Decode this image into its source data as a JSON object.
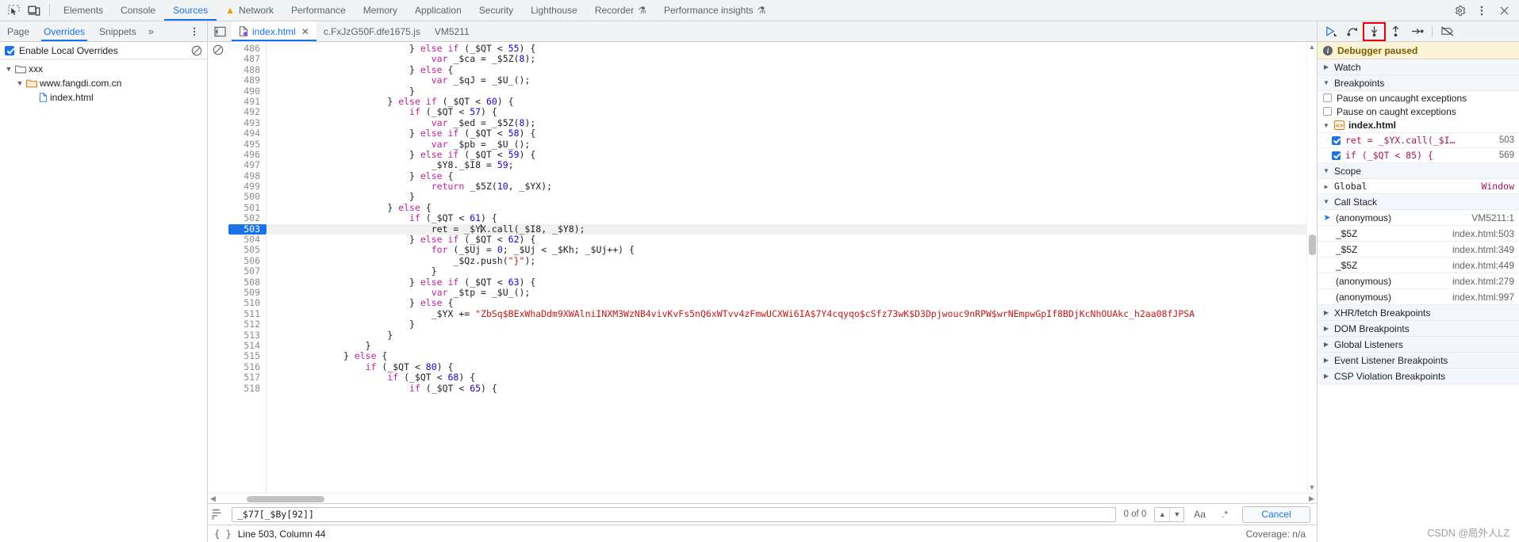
{
  "main_toolbar": {
    "inspect_icon": "inspect-cursor-icon",
    "device_icon": "device-toolbar-icon",
    "tabs": [
      {
        "label": "Elements",
        "active": false,
        "warn": false
      },
      {
        "label": "Console",
        "active": false,
        "warn": false
      },
      {
        "label": "Sources",
        "active": true,
        "warn": false
      },
      {
        "label": "Network",
        "active": false,
        "warn": true
      },
      {
        "label": "Performance",
        "active": false,
        "warn": false
      },
      {
        "label": "Memory",
        "active": false,
        "warn": false
      },
      {
        "label": "Application",
        "active": false,
        "warn": false
      },
      {
        "label": "Security",
        "active": false,
        "warn": false
      },
      {
        "label": "Lighthouse",
        "active": false,
        "warn": false
      },
      {
        "label": "Recorder",
        "active": false,
        "flask": true
      },
      {
        "label": "Performance insights",
        "active": false,
        "flask": true
      }
    ],
    "settings_icon": "gear-icon",
    "more_icon": "three-dots-vertical-icon",
    "close_icon": "close-icon"
  },
  "navigator": {
    "tabs": [
      {
        "label": "Page",
        "active": false
      },
      {
        "label": "Overrides",
        "active": true
      },
      {
        "label": "Snippets",
        "active": false
      }
    ],
    "more_tabs_icon": "chevron-double-right-icon",
    "more_options_icon": "three-dots-vertical-icon",
    "enable_overrides_label": "Enable Local Overrides",
    "enable_overrides_checked": true,
    "clear_icon": "no-entry-icon",
    "tree": [
      {
        "label": "xxx",
        "depth": 0,
        "type": "folder",
        "expanded": true,
        "color": "#5f6368"
      },
      {
        "label": "www.fangdi.com.cn",
        "depth": 1,
        "type": "folder",
        "expanded": true,
        "color": "#e37400"
      },
      {
        "label": "index.html",
        "depth": 2,
        "type": "file",
        "expanded": false,
        "color": "#1a73e8"
      }
    ]
  },
  "editor_tabs": {
    "panel_toggle_icon": "show-navigator-icon",
    "tabs": [
      {
        "label": "index.html",
        "active": true,
        "closable": true,
        "dot": true
      },
      {
        "label": "c.FxJzG50F.dfe1675.js",
        "active": false,
        "closable": false,
        "dot": false
      },
      {
        "label": "VM5211",
        "active": false,
        "closable": false,
        "dot": false
      }
    ],
    "close_icon": "close-icon"
  },
  "debug_buttons": [
    {
      "name": "resume-script-execution",
      "icon": "resume-icon",
      "highlighted": false
    },
    {
      "name": "step-over-next-function-call",
      "icon": "step-over-icon",
      "highlighted": false
    },
    {
      "name": "step-into-next-function-call",
      "icon": "step-into-icon",
      "highlighted": true
    },
    {
      "name": "step-out-of-current-function",
      "icon": "step-out-icon",
      "highlighted": false
    },
    {
      "name": "step",
      "icon": "step-icon",
      "highlighted": false
    },
    {
      "name": "deactivate-breakpoints",
      "icon": "deactivate-breakpoints-icon",
      "highlighted": false
    }
  ],
  "editor": {
    "breakpoint_gutter_icon": "no-entry-icon",
    "current_line": 503,
    "first_line": 486,
    "lines": [
      {
        "n": 486,
        "indent": 26,
        "tokens": [
          [
            "pln",
            "} "
          ],
          [
            "kw",
            "else if"
          ],
          [
            "pln",
            " (_$QT < "
          ],
          [
            "num",
            "55"
          ],
          [
            "pln",
            ") {"
          ]
        ]
      },
      {
        "n": 487,
        "indent": 30,
        "tokens": [
          [
            "kw",
            "var"
          ],
          [
            "pln",
            " _$ca = _$5Z("
          ],
          [
            "num",
            "8"
          ],
          [
            "pln",
            ");"
          ]
        ]
      },
      {
        "n": 488,
        "indent": 26,
        "tokens": [
          [
            "pln",
            "} "
          ],
          [
            "kw",
            "else"
          ],
          [
            "pln",
            " {"
          ]
        ]
      },
      {
        "n": 489,
        "indent": 30,
        "tokens": [
          [
            "kw",
            "var"
          ],
          [
            "pln",
            " _$qJ = _$U_();"
          ]
        ]
      },
      {
        "n": 490,
        "indent": 26,
        "tokens": [
          [
            "pln",
            "}"
          ]
        ]
      },
      {
        "n": 491,
        "indent": 22,
        "tokens": [
          [
            "pln",
            "} "
          ],
          [
            "kw",
            "else if"
          ],
          [
            "pln",
            " (_$QT < "
          ],
          [
            "num",
            "60"
          ],
          [
            "pln",
            ") {"
          ]
        ]
      },
      {
        "n": 492,
        "indent": 26,
        "tokens": [
          [
            "kw",
            "if"
          ],
          [
            "pln",
            " (_$QT < "
          ],
          [
            "num",
            "57"
          ],
          [
            "pln",
            ") {"
          ]
        ]
      },
      {
        "n": 493,
        "indent": 30,
        "tokens": [
          [
            "kw",
            "var"
          ],
          [
            "pln",
            " _$ed = _$5Z("
          ],
          [
            "num",
            "8"
          ],
          [
            "pln",
            ");"
          ]
        ]
      },
      {
        "n": 494,
        "indent": 26,
        "tokens": [
          [
            "pln",
            "} "
          ],
          [
            "kw",
            "else if"
          ],
          [
            "pln",
            " (_$QT < "
          ],
          [
            "num",
            "58"
          ],
          [
            "pln",
            ") {"
          ]
        ]
      },
      {
        "n": 495,
        "indent": 30,
        "tokens": [
          [
            "kw",
            "var"
          ],
          [
            "pln",
            " _$pb = _$U_();"
          ]
        ]
      },
      {
        "n": 496,
        "indent": 26,
        "tokens": [
          [
            "pln",
            "} "
          ],
          [
            "kw",
            "else if"
          ],
          [
            "pln",
            " (_$QT < "
          ],
          [
            "num",
            "59"
          ],
          [
            "pln",
            ") {"
          ]
        ]
      },
      {
        "n": 497,
        "indent": 30,
        "tokens": [
          [
            "pln",
            "_$Y8._$I8 = "
          ],
          [
            "num",
            "59"
          ],
          [
            "pln",
            ";"
          ]
        ]
      },
      {
        "n": 498,
        "indent": 26,
        "tokens": [
          [
            "pln",
            "} "
          ],
          [
            "kw",
            "else"
          ],
          [
            "pln",
            " {"
          ]
        ]
      },
      {
        "n": 499,
        "indent": 30,
        "tokens": [
          [
            "kw",
            "return"
          ],
          [
            "pln",
            " _$5Z("
          ],
          [
            "num",
            "10"
          ],
          [
            "pln",
            ", _$YX);"
          ]
        ]
      },
      {
        "n": 500,
        "indent": 26,
        "tokens": [
          [
            "pln",
            "}"
          ]
        ]
      },
      {
        "n": 501,
        "indent": 22,
        "tokens": [
          [
            "pln",
            "} "
          ],
          [
            "kw",
            "else"
          ],
          [
            "pln",
            " {"
          ]
        ]
      },
      {
        "n": 502,
        "indent": 26,
        "tokens": [
          [
            "kw",
            "if"
          ],
          [
            "pln",
            " (_$QT < "
          ],
          [
            "num",
            "61"
          ],
          [
            "pln",
            ") {"
          ]
        ]
      },
      {
        "n": 503,
        "indent": 30,
        "tokens": [
          [
            "pln",
            "ret = _$Y"
          ],
          [
            "caret",
            ""
          ],
          [
            "pln",
            "X.call(_$I8, _$Y8);"
          ]
        ],
        "highlight": true
      },
      {
        "n": 504,
        "indent": 26,
        "tokens": [
          [
            "pln",
            "} "
          ],
          [
            "kw",
            "else if"
          ],
          [
            "pln",
            " (_$QT < "
          ],
          [
            "num",
            "62"
          ],
          [
            "pln",
            ") {"
          ]
        ]
      },
      {
        "n": 505,
        "indent": 30,
        "tokens": [
          [
            "kw",
            "for"
          ],
          [
            "pln",
            " (_$Uj = "
          ],
          [
            "num",
            "0"
          ],
          [
            "pln",
            "; _$Uj < _$Kh; _$Uj++) {"
          ]
        ]
      },
      {
        "n": 506,
        "indent": 34,
        "tokens": [
          [
            "pln",
            "_$Qz.push("
          ],
          [
            "str",
            "\"}\""
          ],
          [
            "pln",
            ");"
          ]
        ]
      },
      {
        "n": 507,
        "indent": 30,
        "tokens": [
          [
            "pln",
            "}"
          ]
        ]
      },
      {
        "n": 508,
        "indent": 26,
        "tokens": [
          [
            "pln",
            "} "
          ],
          [
            "kw",
            "else if"
          ],
          [
            "pln",
            " (_$QT < "
          ],
          [
            "num",
            "63"
          ],
          [
            "pln",
            ") {"
          ]
        ]
      },
      {
        "n": 509,
        "indent": 30,
        "tokens": [
          [
            "kw",
            "var"
          ],
          [
            "pln",
            " _$tp = _$U_();"
          ]
        ]
      },
      {
        "n": 510,
        "indent": 26,
        "tokens": [
          [
            "pln",
            "} "
          ],
          [
            "kw",
            "else"
          ],
          [
            "pln",
            " {"
          ]
        ]
      },
      {
        "n": 511,
        "indent": 30,
        "tokens": [
          [
            "pln",
            "_$YX += "
          ],
          [
            "str",
            "\"ZbSq$BExWhaDdm9XWAlniINXM3WzNB4vivKvFs5nQ6xWTvv4zFmwUCXWi6IA$7Y4cqyqo$cSfz73wK$D3Dpjwouc9nRPW$wrNEmpwGpIf8BDjKcNhOUAkc_h2aa08fJPSA"
          ]
        ]
      },
      {
        "n": 512,
        "indent": 26,
        "tokens": [
          [
            "pln",
            "}"
          ]
        ]
      },
      {
        "n": 513,
        "indent": 22,
        "tokens": [
          [
            "pln",
            "}"
          ]
        ]
      },
      {
        "n": 514,
        "indent": 18,
        "tokens": [
          [
            "pln",
            "}"
          ]
        ]
      },
      {
        "n": 515,
        "indent": 14,
        "tokens": [
          [
            "pln",
            "} "
          ],
          [
            "kw",
            "else"
          ],
          [
            "pln",
            " {"
          ]
        ]
      },
      {
        "n": 516,
        "indent": 18,
        "tokens": [
          [
            "kw",
            "if"
          ],
          [
            "pln",
            " (_$QT < "
          ],
          [
            "num",
            "80"
          ],
          [
            "pln",
            ") {"
          ]
        ]
      },
      {
        "n": 517,
        "indent": 22,
        "tokens": [
          [
            "kw",
            "if"
          ],
          [
            "pln",
            " (_$QT < "
          ],
          [
            "num",
            "68"
          ],
          [
            "pln",
            ") {"
          ]
        ]
      },
      {
        "n": 518,
        "indent": 26,
        "tokens": [
          [
            "kw",
            "if"
          ],
          [
            "pln",
            " (_$QT < "
          ],
          [
            "num",
            "65"
          ],
          [
            "pln",
            ") {"
          ]
        ]
      }
    ],
    "scroll_left_icon": "chevron-left-icon",
    "scroll_right_icon": "chevron-right-icon",
    "scroll_up_icon": "chevron-up-icon",
    "scroll_down_icon": "chevron-down-icon"
  },
  "search_bar": {
    "search_icon": "search-lines-icon",
    "value": "_$77[_$By[92]]",
    "placeholder": "Find",
    "match_count": "0 of 0",
    "prev_icon": "chevron-up-icon",
    "next_icon": "chevron-down-icon",
    "match_case_label": "Aa",
    "regex_label": ".*",
    "cancel_label": "Cancel"
  },
  "status_bar": {
    "braces_icon": "pretty-print-icon",
    "cursor_position": "Line 503, Column 44",
    "coverage": "Coverage: n/a"
  },
  "debugger": {
    "paused_banner": "Debugger paused",
    "info_icon": "info-icon",
    "sections": {
      "watch": {
        "label": "Watch",
        "expanded": false
      },
      "breakpoints": {
        "label": "Breakpoints",
        "expanded": true
      },
      "scope": {
        "label": "Scope",
        "expanded": true
      },
      "call_stack": {
        "label": "Call Stack",
        "expanded": true
      },
      "xhr": {
        "label": "XHR/fetch Breakpoints",
        "expanded": false
      },
      "dom": {
        "label": "DOM Breakpoints",
        "expanded": false
      },
      "global_listeners": {
        "label": "Global Listeners",
        "expanded": false
      },
      "event_listener": {
        "label": "Event Listener Breakpoints",
        "expanded": false
      },
      "csp": {
        "label": "CSP Violation Breakpoints",
        "expanded": false
      }
    },
    "pause_options": [
      {
        "label": "Pause on uncaught exceptions",
        "checked": false
      },
      {
        "label": "Pause on caught exceptions",
        "checked": false
      }
    ],
    "breakpoint_file": "index.html",
    "breakpoint_items": [
      {
        "code": "ret = _$YX.call(_$I…",
        "line": "503",
        "checked": true
      },
      {
        "code": "if (_$QT < 85) {",
        "line": "569",
        "checked": true
      }
    ],
    "scope_items": [
      {
        "name": "Global",
        "value": "Window",
        "expanded": false
      }
    ],
    "call_stack": [
      {
        "name": "(anonymous)",
        "location": "VM5211:1",
        "active": true
      },
      {
        "name": "_$5Z",
        "location": "index.html:503",
        "active": false
      },
      {
        "name": "_$5Z",
        "location": "index.html:349",
        "active": false
      },
      {
        "name": "_$5Z",
        "location": "index.html:449",
        "active": false
      },
      {
        "name": "(anonymous)",
        "location": "index.html:279",
        "active": false
      },
      {
        "name": "(anonymous)",
        "location": "index.html:997",
        "active": false
      }
    ]
  },
  "watermark": "CSDN @局外人LZ"
}
